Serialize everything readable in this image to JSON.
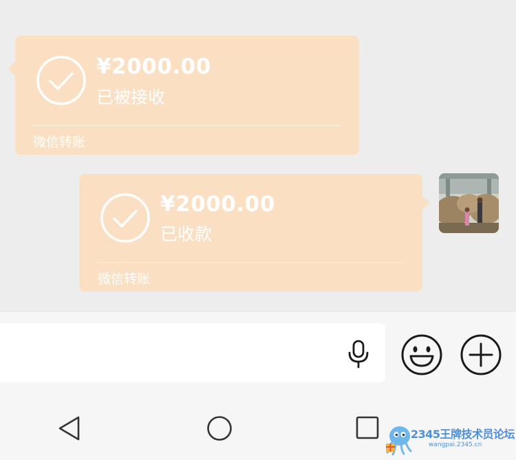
{
  "messages": [
    {
      "side": "received",
      "amount": "¥2000.00",
      "status": "已被接收",
      "footer": "微信转账"
    },
    {
      "side": "sent",
      "amount": "¥2000.00",
      "status": "已收款",
      "footer": "微信转账"
    }
  ],
  "input_bar": {
    "value": "",
    "icons": [
      "mic-icon",
      "emoji-icon",
      "plus-icon"
    ]
  },
  "nav": {
    "icons": [
      "back-triangle-icon",
      "home-circle-icon",
      "recents-square-icon"
    ]
  },
  "watermark": {
    "title": "2345王牌技术员论坛",
    "url": "wangpai.2345.cn"
  },
  "colors": {
    "bubble": "#fbdfc2",
    "background": "#ededed",
    "bar": "#f6f6f6"
  }
}
